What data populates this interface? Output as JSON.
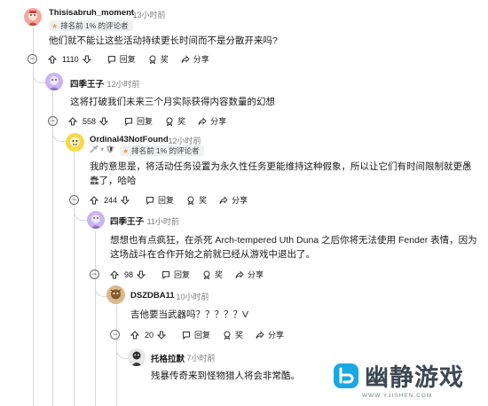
{
  "comments": [
    {
      "username": "Thisisabruh_moment",
      "time": "· 13小时前",
      "badge": "排名前 1% 的评论者",
      "text": "他们就不能让这些活动持续更长时间而不是分散开来吗?",
      "votes": "1110",
      "reply": "回复",
      "award": "奖",
      "share": "分享"
    },
    {
      "username": "四季王子",
      "time": "· 12小时前",
      "text": "这将打破我们未来三个月实际获得内容数量的幻想",
      "votes": "558",
      "reply": "回复",
      "award": "奖",
      "share": "分享"
    },
    {
      "username": "Ordinal43NotFound",
      "time": "· 12小时前",
      "flair": "🗡♆🛡",
      "badge": "排名前 1% 的评论者",
      "text": "我的意思是，将活动任务设置为永久性任务更能维持这种假象，所以让它们有时间限制就更愚蠢了，哈哈",
      "votes": "244",
      "reply": "回复",
      "award": "奖",
      "share": "分享"
    },
    {
      "username": "四季王子",
      "time": "· 11小时前",
      "text": "想想也有点疯狂，在杀死 Arch-tempered Uth Duna 之后你将无法使用 Fender 表情，因为这场战斗在合作开始之前就已经从游戏中退出了。",
      "votes": "98",
      "reply": "回复",
      "award": "奖",
      "share": "分享"
    },
    {
      "username": "DSZDBA11",
      "time": "· 10小时前",
      "text": "吉他要当武器吗？？？？？V",
      "votes": "20",
      "reply": "回复",
      "award": "奖",
      "share": "分享"
    },
    {
      "username": "托格拉默",
      "time": "· 7小时前",
      "text": "残暴传奇来到怪物猎人将会非常酷。"
    }
  ],
  "watermark": {
    "text": "幽静游戏",
    "url": "WWW.YJISHEN.COM"
  },
  "colors": {
    "accent_logo": "#1aa8e3",
    "thread_line": "#d9d9d9",
    "badge_bg": "#eef0f2"
  },
  "icons": [
    "upvote-icon",
    "downvote-icon",
    "reply-icon",
    "award-icon",
    "share-icon",
    "collapse-icon",
    "star-icon"
  ]
}
